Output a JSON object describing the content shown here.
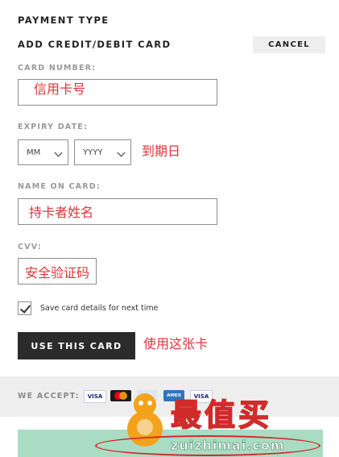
{
  "title": "PAYMENT TYPE",
  "subtitle": "ADD CREDIT/DEBIT CARD",
  "cancel_label": "CANCEL",
  "fields": {
    "card_number_label": "CARD NUMBER:",
    "card_number_annot": "信用卡号",
    "expiry_label": "EXPIRY DATE:",
    "month_value": "MM",
    "year_value": "YYYY",
    "expiry_annot": "到期日",
    "name_label": "NAME ON CARD:",
    "name_annot": "持卡者姓名",
    "cvv_label": "CVV:",
    "cvv_annot": "安全验证码"
  },
  "save_card_label": "Save card details for next time",
  "save_card_checked": true,
  "use_card_label": "USE THIS CARD",
  "use_card_annot": "使用这张卡",
  "accept": {
    "label": "WE ACCEPT:",
    "cards": [
      "VISA",
      "mastercard",
      "",
      "AMEX",
      "VISA"
    ]
  },
  "watermark": {
    "brand": "最值买",
    "url": "zuizhimai.com"
  }
}
